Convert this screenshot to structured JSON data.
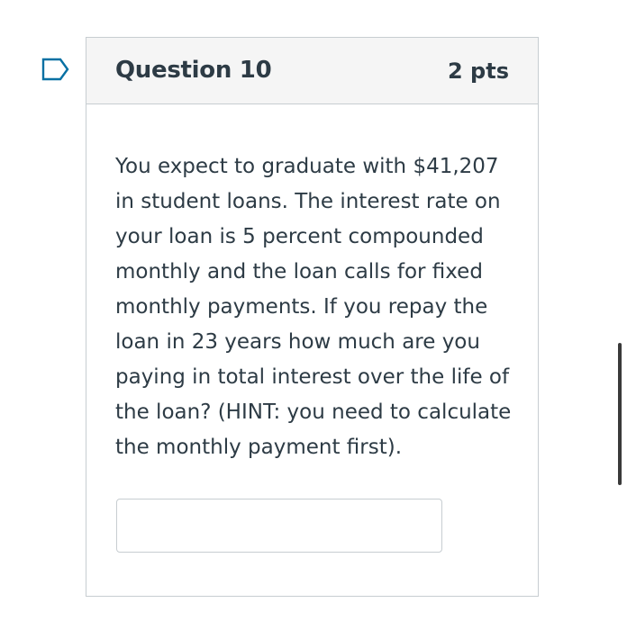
{
  "question": {
    "title": "Question 10",
    "points": "2 pts",
    "text": "You expect to graduate with $41,207 in student loans. The interest rate on your loan is 5 percent compounded monthly and the loan calls for fixed monthly payments. If you repay the loan in 23 years how much are you paying in total interest over the life of the loan? (HINT: you need to calculate the monthly payment first).",
    "answer_value": "",
    "answer_placeholder": ""
  },
  "icons": {
    "flag": "bookmark-flag-icon"
  },
  "colors": {
    "flag_accent": "#0770a3",
    "text": "#2d3b45",
    "border": "#c7cdd1",
    "header_bg": "#f5f5f5"
  }
}
